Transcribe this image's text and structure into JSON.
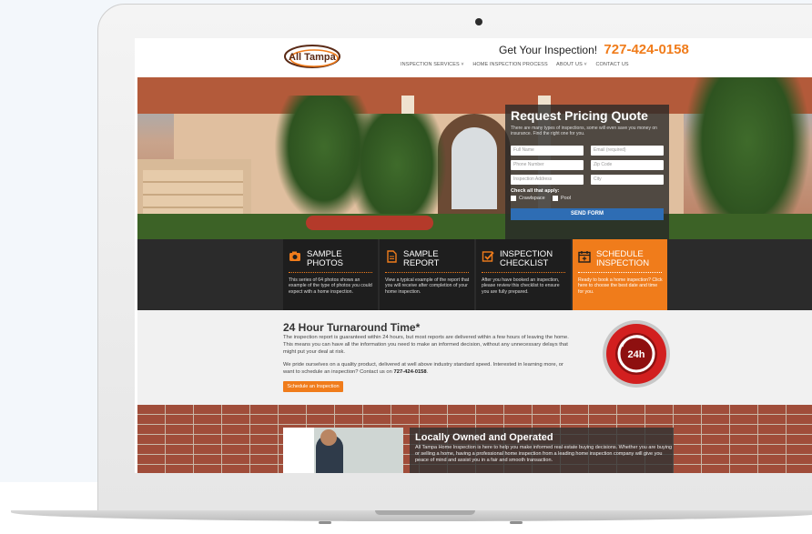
{
  "header": {
    "logo_text": "All Tampa",
    "cta_text": "Get Your Inspection!",
    "phone": "727-424-0158"
  },
  "nav": {
    "items": [
      {
        "label": "INSPECTION SERVICES ˅"
      },
      {
        "label": "HOME INSPECTION PROCESS"
      },
      {
        "label": "ABOUT US ˅"
      },
      {
        "label": "CONTACT US"
      }
    ]
  },
  "quote_form": {
    "title": "Request Pricing Quote",
    "description": "There are many types of inspections, some will even save you money on insurance. Find the right one for you.",
    "fields": {
      "full_name": "Full Name",
      "email": "Email (required)",
      "phone": "Phone Number",
      "zip": "Zip Code",
      "address": "Inspection Address",
      "city": "City"
    },
    "check_label": "Check all that apply:",
    "options": [
      "Crawlspace",
      "Pool"
    ],
    "submit": "SEND FORM"
  },
  "features": [
    {
      "title": "SAMPLE PHOTOS",
      "text": "This series of 64 photos shows an example of the type of photos you could expect with a home inspection.",
      "icon": "camera-icon"
    },
    {
      "title": "SAMPLE REPORT",
      "text": "View a typical example of the report that you will receive after completion of your home inspection.",
      "icon": "document-icon"
    },
    {
      "title": "INSPECTION CHECKLIST",
      "text": "After you have booked an inspection, please review this checklist to ensure you are fully prepared.",
      "icon": "checkbox-icon"
    },
    {
      "title": "SCHEDULE INSPECTION",
      "text": "Ready to book a home inspection? Click here to choose the best date and time for you.",
      "icon": "calendar-icon"
    }
  ],
  "turnaround": {
    "title": "24 Hour Turnaround Time*",
    "p1": "The inspection report is guaranteed within 24 hours, but most reports are delivered within a few hours of leaving the home. This means you can have all the information you need to make an informed decision, without any unnecessary delays that might put your deal at risk.",
    "p2": "We pride ourselves on a quality product, delivered at well above industry standard speed. Interested in learning more, or want to schedule an inspection? Contact us on",
    "p2_phone": "727-424-0158",
    "p2_end": ".",
    "button": "Schedule an Inspection",
    "badge_text": "24h"
  },
  "local": {
    "title": "Locally Owned and Operated",
    "text": "All Tampa Home Inspection is here to help you make informed real estate buying decisions. Whether you are buying or selling a home, having a professional home inspection from a leading home inspection company will give you peace of mind and assist you in a fair and smooth transaction."
  },
  "colors": {
    "accent": "#f07c1b",
    "form_button": "#2e6db4",
    "dark_strip": "#1e1e1e"
  }
}
